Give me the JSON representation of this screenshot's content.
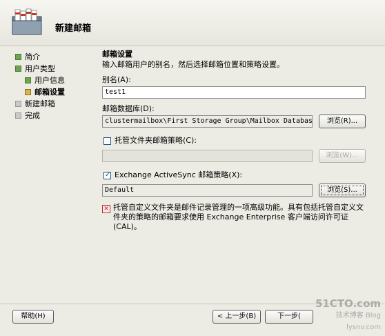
{
  "header": {
    "title": "新建邮箱",
    "icon": "mailbox-icon"
  },
  "nav": {
    "items": [
      {
        "label": "简介",
        "state": "done"
      },
      {
        "label": "用户类型",
        "state": "done"
      },
      {
        "label": "用户信息",
        "state": "done",
        "sub": true
      },
      {
        "label": "邮箱设置",
        "state": "current",
        "sub": true
      },
      {
        "label": "新建邮箱",
        "state": "pending"
      },
      {
        "label": "完成",
        "state": "pending"
      }
    ]
  },
  "content": {
    "section_title": "邮箱设置",
    "section_desc": "输入邮箱用户的别名，然后选择邮箱位置和策略设置。",
    "alias": {
      "label": "别名(A):",
      "value": "test1"
    },
    "database": {
      "label": "邮箱数据库(D):",
      "value": "clustermailbox\\First Storage Group\\Mailbox Database",
      "browse_label": "浏览(R)..."
    },
    "managed_folder": {
      "label": "托管文件夹邮箱策略(C):",
      "checked": false,
      "value": "",
      "browse_label": "浏览(W)..."
    },
    "activesync": {
      "label": "Exchange ActiveSync 邮箱策略(X):",
      "checked": true,
      "value": "Default",
      "browse_label": "浏览(S)..."
    },
    "note": "托管自定义文件夹是邮件记录管理的一项高级功能。具有包括托管自定义文件夹的策略的邮箱要求使用 Exchange Enterprise 客户端访问许可证(CAL)。"
  },
  "footer": {
    "help_label": "帮助(H)",
    "back_label": "< 上一步(B)",
    "next_label": "下一步("
  },
  "watermark": {
    "line1": "51CTO.com",
    "line2": "技术博客  Blog",
    "line3": "lysnv.com"
  },
  "colors": {
    "done": "#6ca54b",
    "current": "#d9b44a",
    "pending": "#c9c9c9",
    "background": "#ecebe4"
  }
}
